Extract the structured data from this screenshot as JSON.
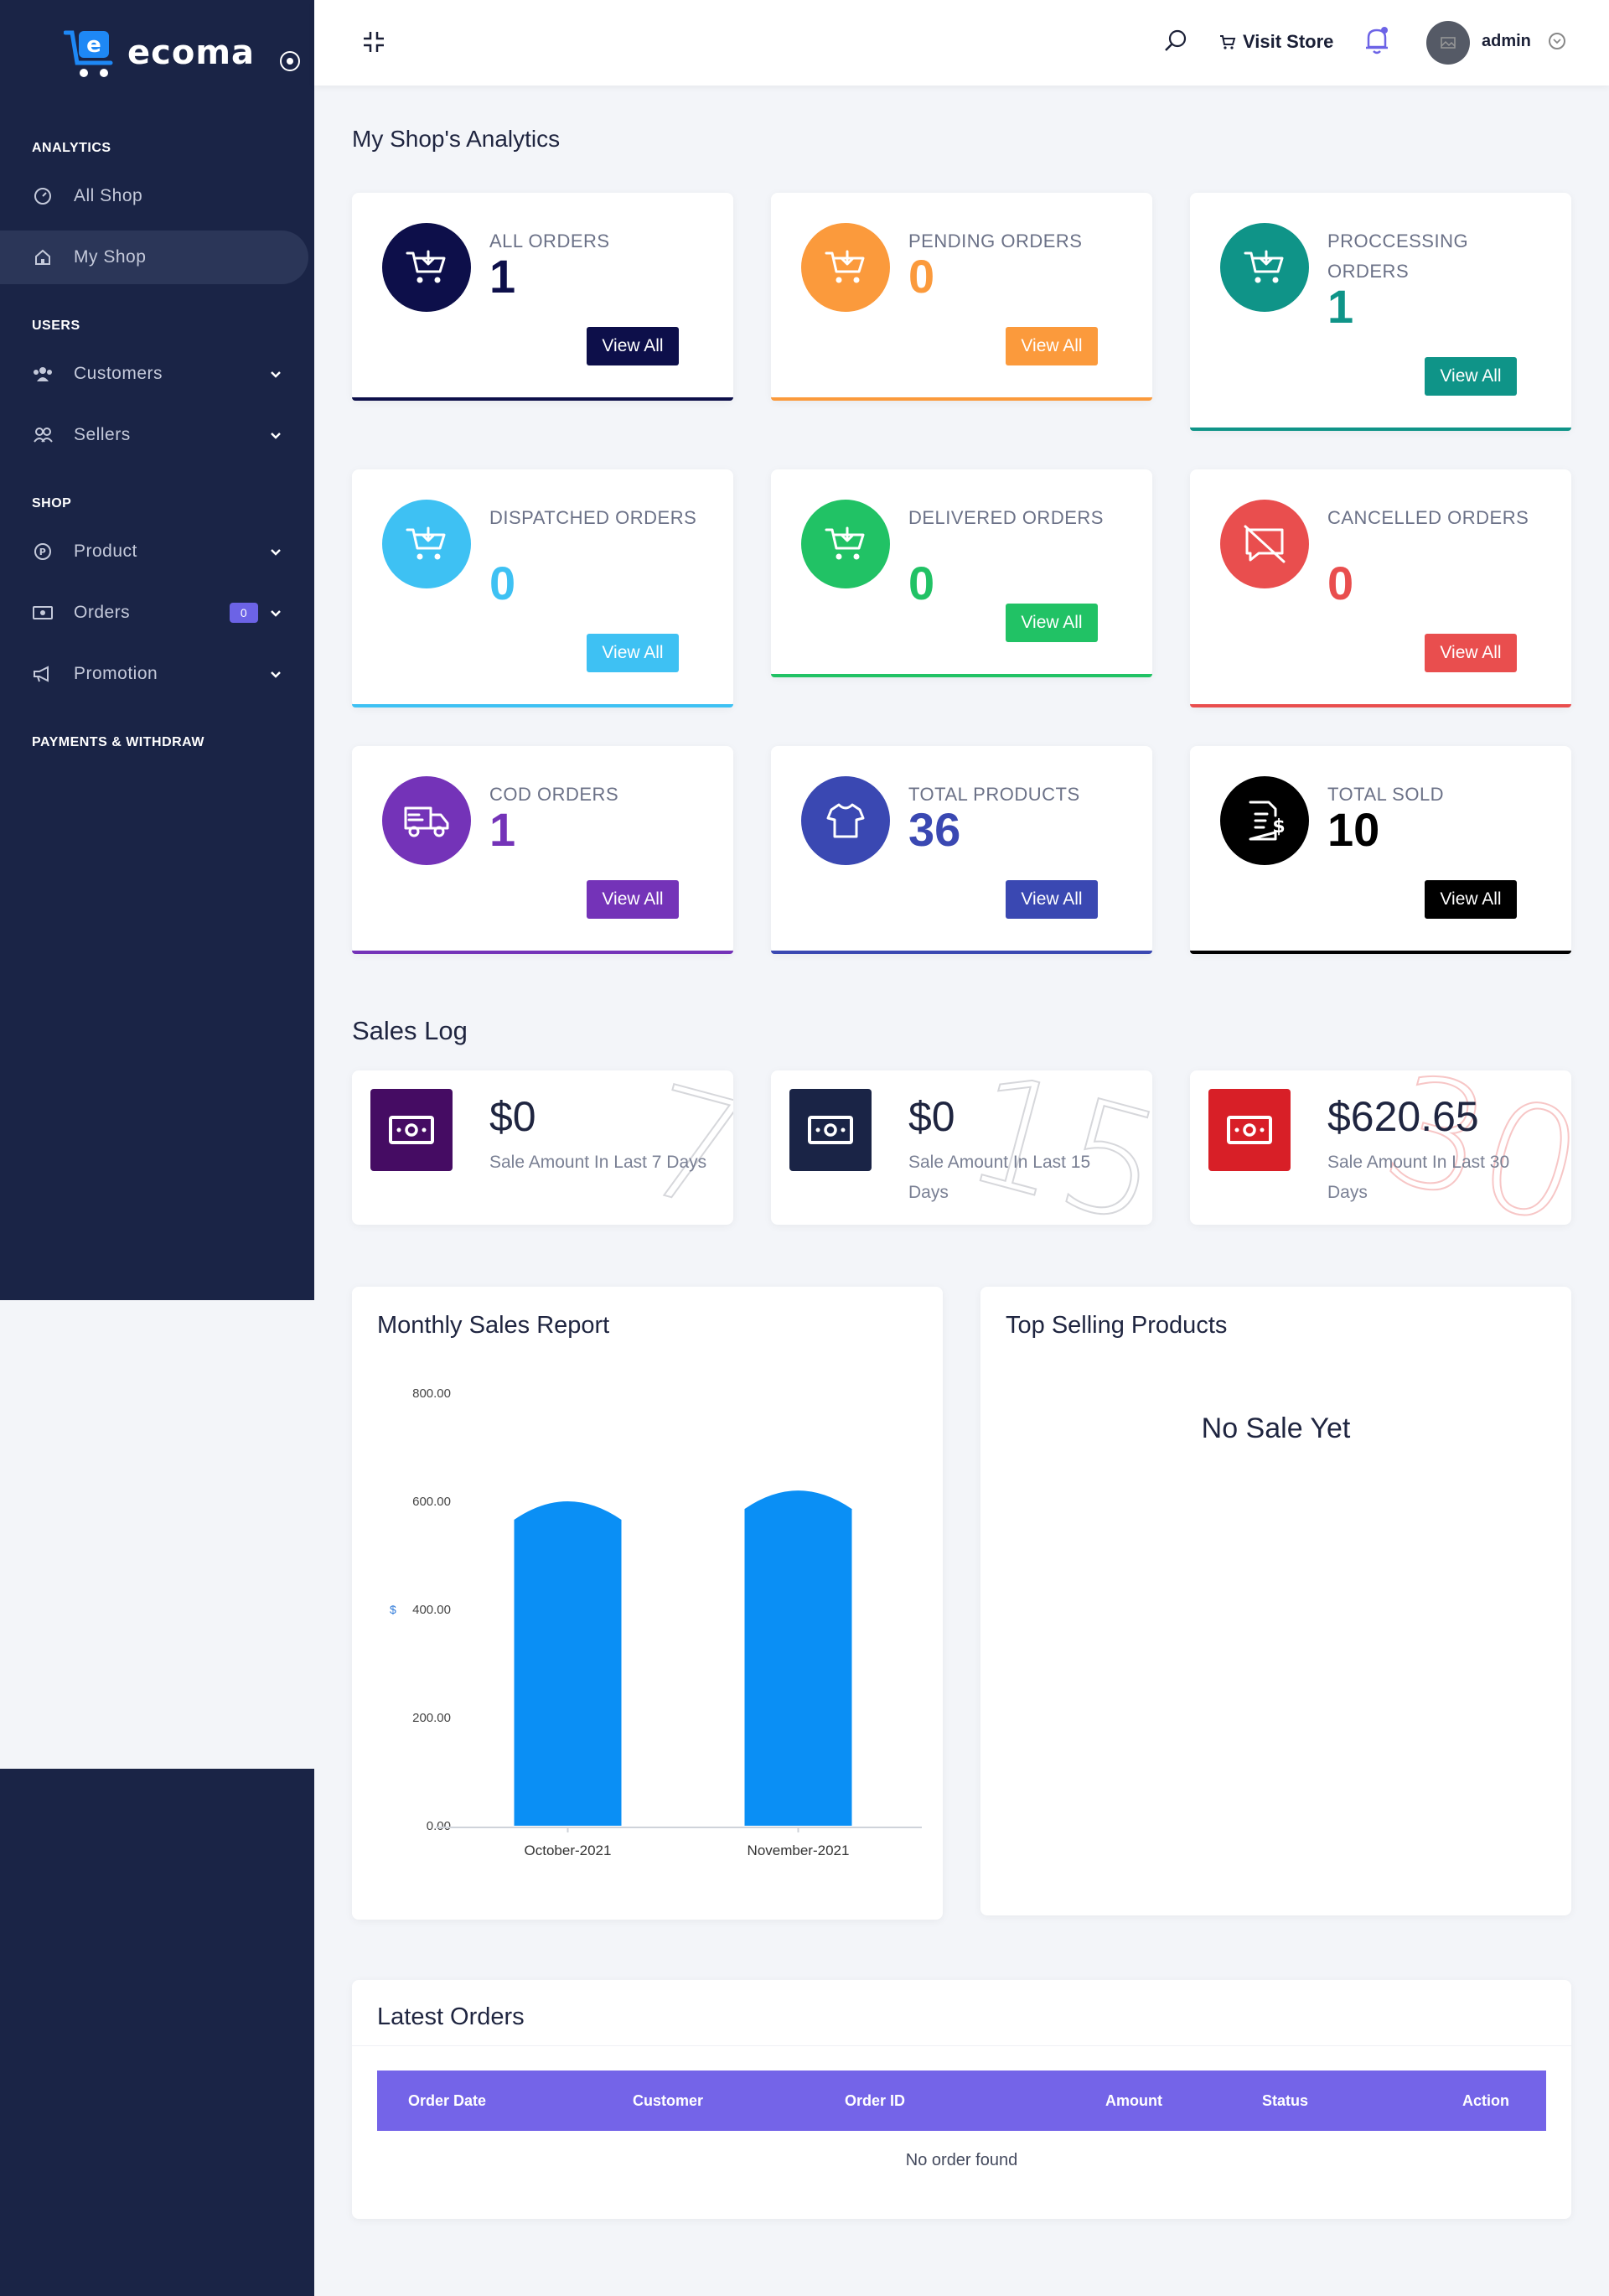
{
  "brand": {
    "name": "ecoma"
  },
  "sidebar": {
    "sections": [
      {
        "title": "ANALYTICS"
      },
      {
        "title": "USERS"
      },
      {
        "title": "SHOP"
      },
      {
        "title": "PAYMENTS & WITHDRAW"
      }
    ],
    "items": [
      {
        "label": "All Shop",
        "icon": "gauge-icon"
      },
      {
        "label": "My Shop",
        "icon": "home-icon",
        "active": true
      },
      {
        "label": "Customers",
        "icon": "users-icon"
      },
      {
        "label": "Sellers",
        "icon": "sellers-icon"
      },
      {
        "label": "Product",
        "icon": "product-icon"
      },
      {
        "label": "Orders",
        "icon": "orders-icon",
        "badge": "0"
      },
      {
        "label": "Promotion",
        "icon": "megaphone-icon"
      }
    ]
  },
  "header": {
    "visit_store": "Visit Store",
    "user": "admin"
  },
  "page": {
    "title": "My Shop's Analytics"
  },
  "stats": [
    {
      "label": "ALL ORDERS",
      "value": "1",
      "button": "View All",
      "color": "#0d0f4a"
    },
    {
      "label": "PENDING ORDERS",
      "value": "0",
      "button": "View All",
      "color": "#fb9a3c"
    },
    {
      "label": "PROCCESSING ORDERS",
      "value": "1",
      "button": "View All",
      "color": "#0f9488"
    },
    {
      "label": "DISPATCHED ORDERS",
      "value": "0",
      "button": "View All",
      "color": "#3ec1f3"
    },
    {
      "label": "DELIVERED ORDERS",
      "value": "0",
      "button": "View All",
      "color": "#21c265"
    },
    {
      "label": "CANCELLED ORDERS",
      "value": "0",
      "button": "View All",
      "color": "#e94e4e"
    },
    {
      "label": "COD ORDERS",
      "value": "1",
      "button": "View All",
      "color": "#7433b8"
    },
    {
      "label": "TOTAL PRODUCTS",
      "value": "36",
      "button": "View All",
      "color": "#3a48b2"
    },
    {
      "label": "TOTAL SOLD",
      "value": "10",
      "button": "View All",
      "color": "#000000"
    }
  ],
  "sales_log": {
    "title": "Sales Log",
    "cards": [
      {
        "amount": "$0",
        "desc": "Sale Amount In Last 7 Days",
        "bg_number": "7",
        "color": "#450c63"
      },
      {
        "amount": "$0",
        "desc": "Sale Amount In Last 15 Days",
        "bg_number": "15",
        "color": "#1a2446"
      },
      {
        "amount": "$620.65",
        "desc": "Sale Amount In Last 30 Days",
        "bg_number": "30",
        "color": "#d81f27"
      }
    ]
  },
  "monthly_report": {
    "title": "Monthly Sales Report"
  },
  "chart_data": {
    "type": "bar",
    "categories": [
      "October-2021",
      "November-2021"
    ],
    "values": [
      600,
      620
    ],
    "ylabel": "$",
    "ylim": [
      0,
      800
    ],
    "yticks": [
      "0.00",
      "200.00",
      "400.00",
      "600.00",
      "800.00"
    ],
    "grid": false,
    "color": "#0a8ff5"
  },
  "top_selling": {
    "title": "Top Selling Products",
    "empty": "No Sale Yet"
  },
  "latest_orders": {
    "title": "Latest Orders",
    "columns": [
      "Order Date",
      "Customer",
      "Order ID",
      "Amount",
      "Status",
      "Action"
    ],
    "empty": "No order found"
  }
}
